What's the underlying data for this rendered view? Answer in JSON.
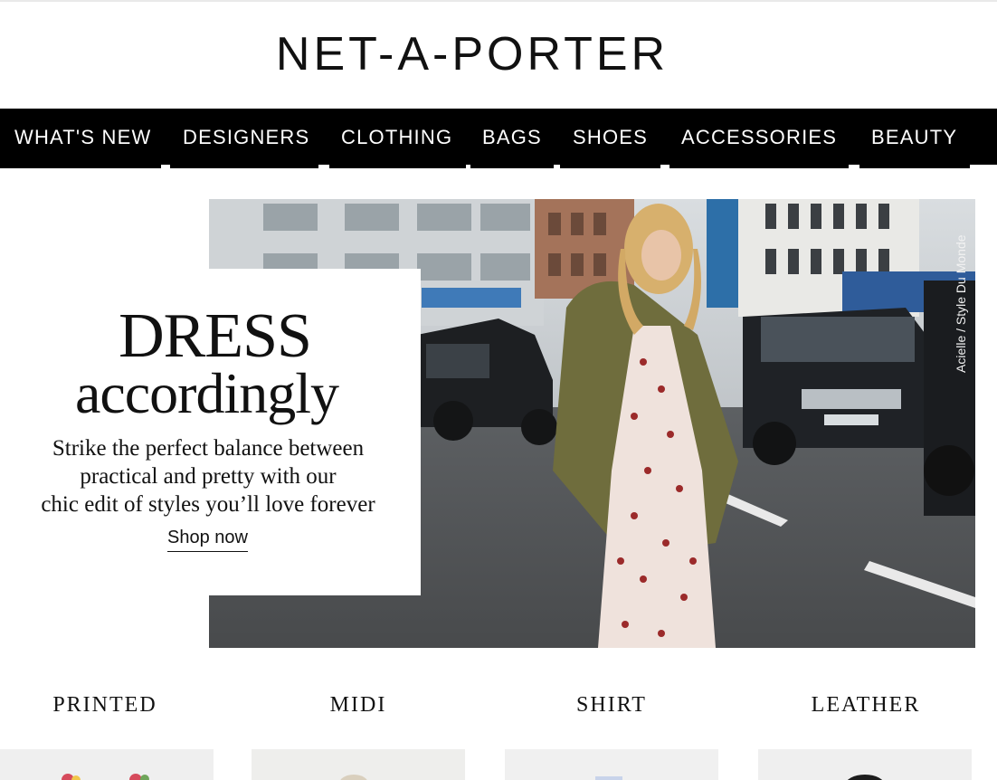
{
  "brand": {
    "logo_text": "NET-A-PORTER"
  },
  "nav": {
    "items": [
      {
        "label": "WHAT'S NEW"
      },
      {
        "label": "DESIGNERS"
      },
      {
        "label": "CLOTHING"
      },
      {
        "label": "BAGS"
      },
      {
        "label": "SHOES"
      },
      {
        "label": "ACCESSORIES"
      },
      {
        "label": "BEAUTY"
      }
    ]
  },
  "hero": {
    "title_line1": "DRESS",
    "title_line2": "accordingly",
    "body_line1": "Strike the perfect balance between",
    "body_line2": "practical and pretty with our",
    "body_line3": "chic edit of styles you’ll love forever",
    "cta_label": "Shop now",
    "photo_credit": "Acielle / Style Du Monde"
  },
  "categories": [
    {
      "label": "PRINTED"
    },
    {
      "label": "MIDI"
    },
    {
      "label": "SHIRT"
    },
    {
      "label": "LEATHER"
    }
  ],
  "colors": {
    "nav_bg": "#000000",
    "nav_text": "#ffffff",
    "page_bg": "#ffffff"
  }
}
